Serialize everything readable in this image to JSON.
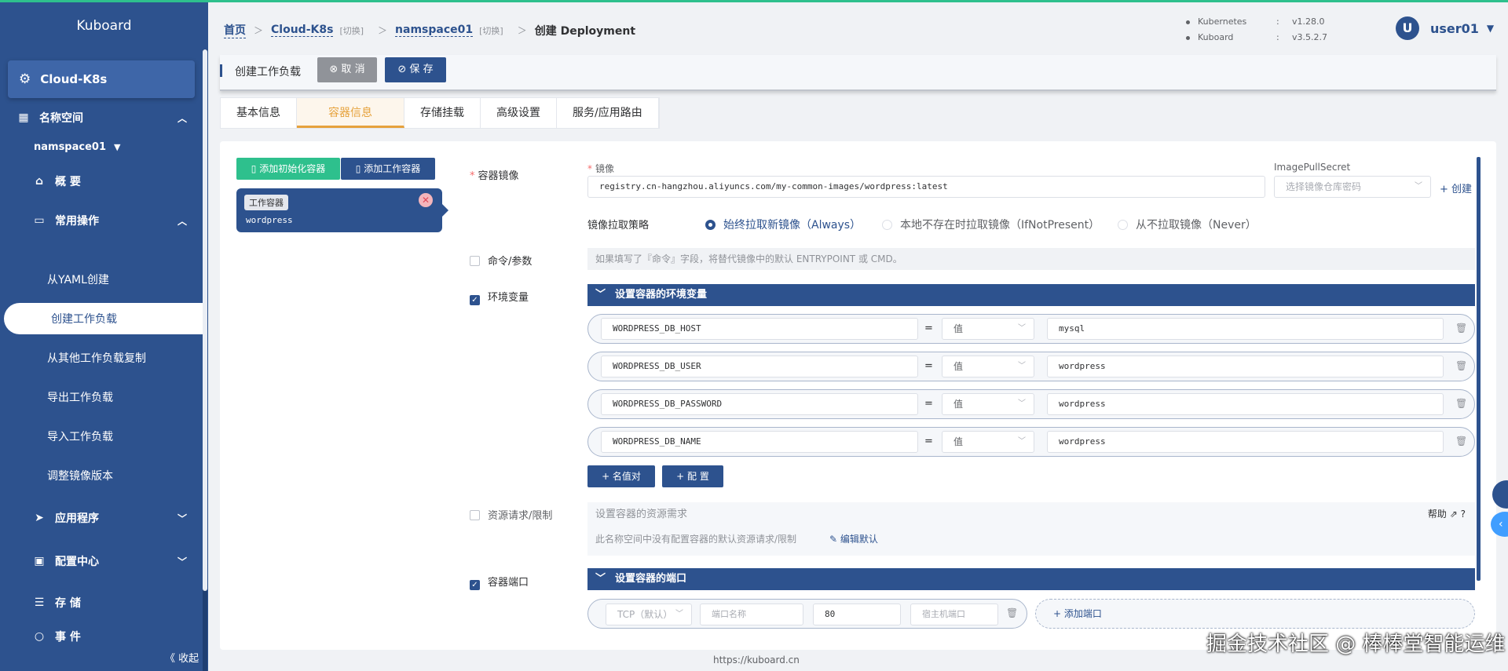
{
  "sidebar": {
    "brand": "Kuboard",
    "cluster": "Cloud-K8s",
    "namespace_section": "名称空间",
    "namespace": "namspace01",
    "overview": "概 要",
    "common_ops": "常用操作",
    "items": [
      "从YAML创建",
      "创建工作负载",
      "从其他工作负载复制",
      "导出工作负载",
      "导入工作负载",
      "调整镜像版本"
    ],
    "apps": "应用程序",
    "config": "配置中心",
    "storage": "存 储",
    "events": "事 件",
    "collapse": "《 收起"
  },
  "header": {
    "crumbs": {
      "home": "首页",
      "cluster": "Cloud-K8s",
      "switch": "[切换]",
      "namespace": "namspace01",
      "current": "创建 Deployment"
    },
    "versions": [
      {
        "key": "Kubernetes",
        "value": "v1.28.0"
      },
      {
        "key": "Kuboard",
        "value": "v3.5.2.7"
      }
    ],
    "user": {
      "avatar": "U",
      "name": "user01"
    }
  },
  "toolbar": {
    "title": "创建工作负载",
    "cancel": "⊗ 取 消",
    "save": "⊘ 保 存"
  },
  "tabs": [
    "基本信息",
    "容器信息",
    "存储挂载",
    "高级设置",
    "服务/应用路由"
  ],
  "containers": {
    "add_init": "添加初始化容器",
    "add_work": "添加工作容器",
    "card_tag": "工作容器",
    "card_name": "wordpress"
  },
  "image": {
    "label": "容器镜像",
    "field_label": "镜像",
    "value": "registry.cn-hangzhou.aliyuncs.com/my-common-images/wordpress:latest",
    "secret_label": "ImagePullSecret",
    "secret_placeholder": "选择镜像仓库密码",
    "create": "+ 创建"
  },
  "pull_policy": {
    "label": "镜像拉取策略",
    "options": [
      "始终拉取新镜像（Always）",
      "本地不存在时拉取镜像（IfNotPresent）",
      "从不拉取镜像（Never）"
    ],
    "selected": 0
  },
  "command": {
    "label": "命令/参数",
    "placeholder": "如果填写了『命令』字段，将替代镜像中的默认 ENTRYPOINT 或 CMD。"
  },
  "env": {
    "label": "环境变量",
    "title": "设置容器的环境变量",
    "rows": [
      {
        "name": "WORDPRESS_DB_HOST",
        "type": "值",
        "value": "mysql"
      },
      {
        "name": "WORDPRESS_DB_USER",
        "type": "值",
        "value": "wordpress"
      },
      {
        "name": "WORDPRESS_DB_PASSWORD",
        "type": "值",
        "value": "wordpress"
      },
      {
        "name": "WORDPRESS_DB_NAME",
        "type": "值",
        "value": "wordpress"
      }
    ],
    "add_pair": "+ 名值对",
    "add_config": "+ 配 置"
  },
  "resources": {
    "label": "资源请求/限制",
    "title": "设置容器的资源需求",
    "help": "帮助",
    "note": "此名称空间中没有配置容器的默认资源请求/限制",
    "edit": "编辑默认"
  },
  "ports": {
    "label": "容器端口",
    "title": "设置容器的端口",
    "protocol": "TCP（默认）",
    "name_placeholder": "端口名称",
    "port": "80",
    "host_placeholder": "宿主机端口",
    "add": "+ 添加端口"
  },
  "footer": "https://kuboard.cn",
  "watermark": "掘金技术社区 @ 棒棒堂智能运维"
}
